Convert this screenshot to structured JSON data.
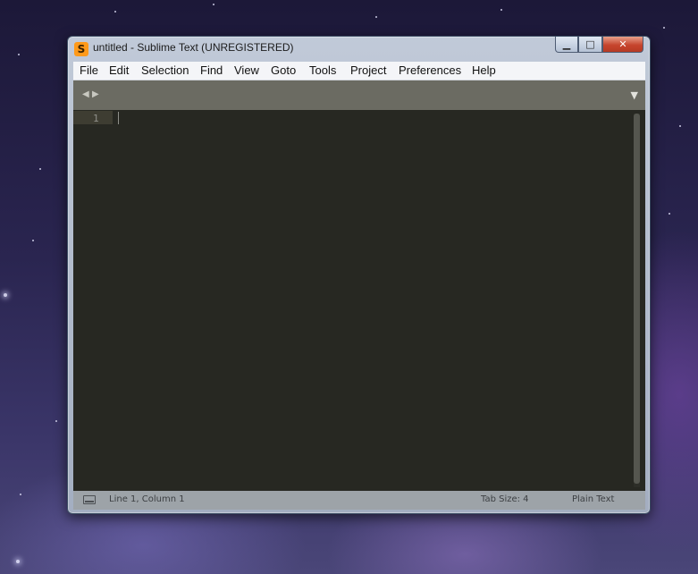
{
  "window": {
    "app_icon": "sublime-text-icon",
    "app_icon_glyph": "S",
    "title": "untitled - Sublime Text (UNREGISTERED)",
    "controls": {
      "minimize": "▁",
      "maximize": "□",
      "close": "✕"
    }
  },
  "menubar": {
    "items": [
      "File",
      "Edit",
      "Selection",
      "Find",
      "View",
      "Goto",
      "Tools",
      "Project",
      "Preferences",
      "Help"
    ]
  },
  "tabstrip": {
    "prev": "◀",
    "next": "▶",
    "dropdown": "▼"
  },
  "editor": {
    "line_numbers": [
      "1"
    ],
    "content": ""
  },
  "statusbar": {
    "icon": "panel-toggle-icon",
    "position": "Line 1, Column 1",
    "tab_size": "Tab Size: 4",
    "syntax": "Plain Text"
  },
  "colors": {
    "editor_bg": "#272822",
    "tabstrip_bg": "#6b6b62",
    "statusbar_bg": "#9da3a8",
    "app_icon": "#ff9a1a",
    "close_button": "#c6452e"
  }
}
